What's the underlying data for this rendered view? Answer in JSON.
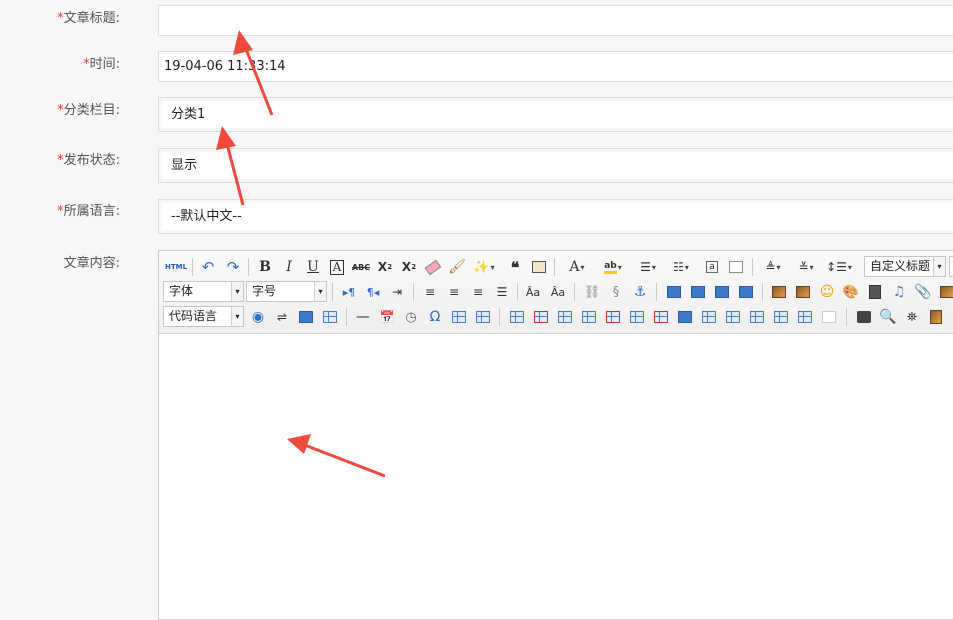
{
  "form": {
    "title_field": {
      "required_mark": "*",
      "label": "文章标题:",
      "value": ""
    },
    "time_field": {
      "required_mark": "*",
      "label": "时间:",
      "value": "19-04-06 11:33:14"
    },
    "category_field": {
      "required_mark": "*",
      "label": "分类栏目:",
      "value": "分类1"
    },
    "status_field": {
      "required_mark": "*",
      "label": "发布状态:",
      "value": "显示"
    },
    "language_field": {
      "required_mark": "*",
      "label": "所属语言:",
      "value": "--默认中文--"
    },
    "content_field": {
      "label": "文章内容:"
    }
  },
  "editor": {
    "html_label": "HTML",
    "heading_select": "自定义标题",
    "font_select": "字体",
    "size_select": "字号",
    "code_select": "代码语言"
  },
  "annotation_color": "#f04a3c"
}
